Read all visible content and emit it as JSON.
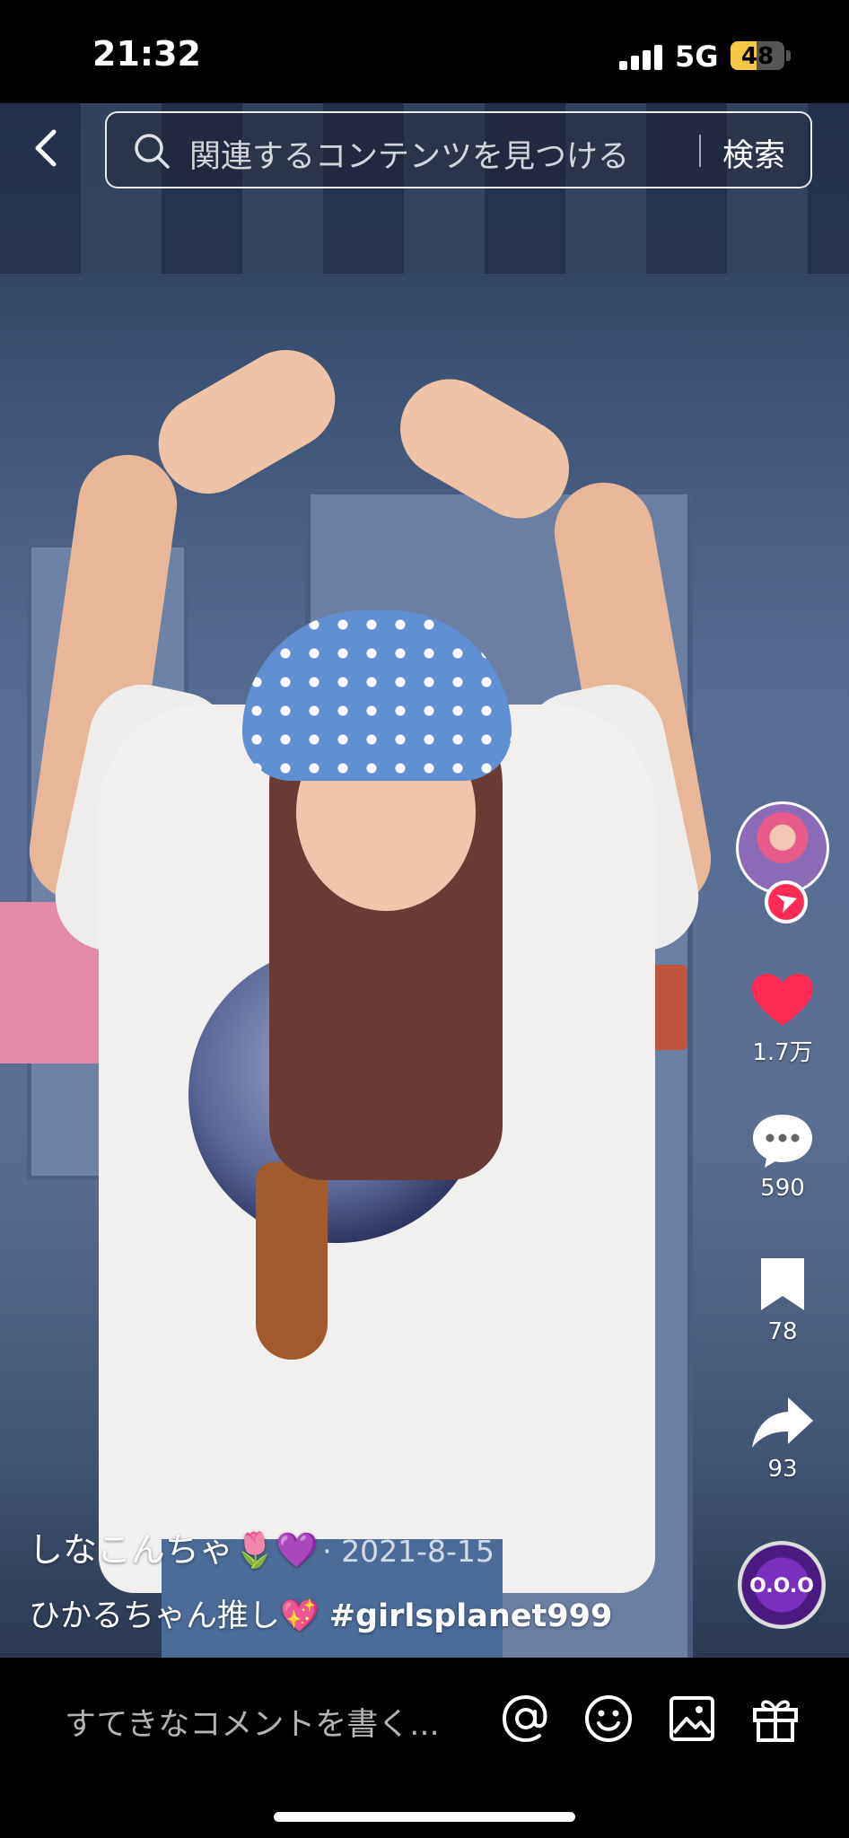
{
  "status": {
    "time": "21:32",
    "network": "5G",
    "battery": "48"
  },
  "search": {
    "placeholder": "関連するコンテンツを見つける",
    "button": "検索"
  },
  "actions": {
    "likes": "1.7万",
    "comments": "590",
    "saves": "78",
    "shares": "93"
  },
  "post": {
    "username": "しなこんちゃ🌷💜",
    "date": "· 2021-8-15",
    "text": "ひかるちゃん推し💖",
    "hashtag": "#girlsplanet999"
  },
  "music": {
    "disc_text": "O.O.O"
  },
  "comment": {
    "placeholder": "すてきなコメントを書く..."
  },
  "colors": {
    "like": "#fe2c55",
    "battery": "#f6c945"
  }
}
